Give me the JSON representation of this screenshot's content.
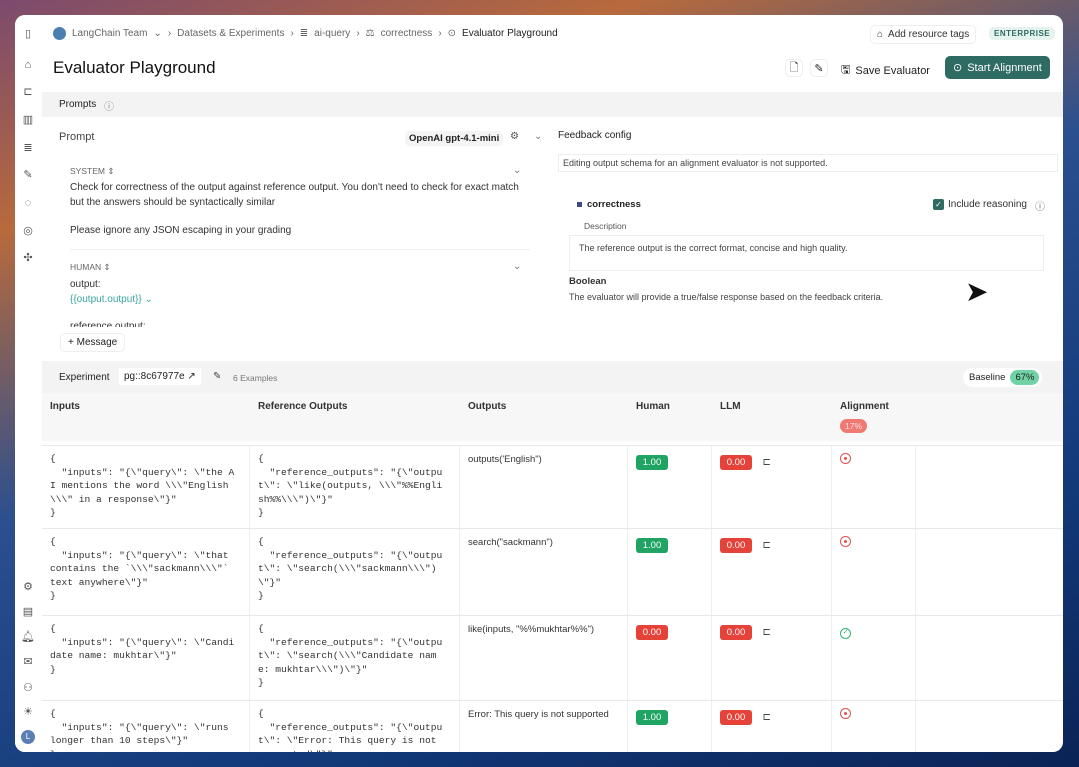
{
  "breadcrumb": {
    "org": "LangChain Team",
    "items": [
      "Datasets & Experiments",
      "ai-query",
      "correctness",
      "Evaluator Playground"
    ]
  },
  "header": {
    "add_tags": "Add resource tags",
    "plan": "ENTERPRISE",
    "title": "Evaluator Playground",
    "save": "Save Evaluator",
    "start": "Start Alignment"
  },
  "prompts": {
    "label": "Prompts",
    "prompt_label": "Prompt",
    "model": "OpenAI gpt-4.1-mini",
    "system_role": "SYSTEM",
    "system_text": "Check for correctness of the output against reference output. You don't need to check for exact match but the answers should be syntactically similar",
    "system_text2": "Please ignore any JSON escaping in your grading",
    "human_role": "HUMAN",
    "human_line1": "output:",
    "human_var": "{{output.output}}",
    "human_line3": "reference output:",
    "add_message": "+ Message"
  },
  "feedback": {
    "title": "Feedback config",
    "notice": "Editing output schema for an alignment evaluator is not supported.",
    "name": "correctness",
    "include_reasoning": "Include reasoning",
    "include_reasoning_checked": true,
    "desc_label": "Description",
    "desc": "The reference output is the correct format, concise and high quality.",
    "type": "Boolean",
    "type_desc": "The evaluator will provide a true/false response based on the feedback criteria."
  },
  "experiment": {
    "label": "Experiment",
    "id": "pg::8c67977e",
    "examples": "6 Examples",
    "baseline_label": "Baseline",
    "baseline": "67%"
  },
  "table": {
    "columns": [
      "Inputs",
      "Reference Outputs",
      "Outputs",
      "Human",
      "LLM",
      "Alignment"
    ],
    "alignment_score": "17%",
    "rows": [
      {
        "input": "{\n  \"inputs\": \"{\\\"query\\\": \\\"the AI mentions the word \\\\\\\"English\\\\\\\" in a response\\\"}\"\n}",
        "ref": "{\n  \"reference_outputs\": \"{\\\"output\\\": \\\"like(outputs, \\\\\\\"%%English%%\\\\\\\")\\\"}\"\n}",
        "output": "outputs('English\")",
        "human": "1.00",
        "llm": "0.00",
        "aligned": false
      },
      {
        "input": "{\n  \"inputs\": \"{\\\"query\\\": \\\"that contains the `\\\\\\\"sackmann\\\\\\\"` text anywhere\\\"}\"\n}",
        "ref": "{\n  \"reference_outputs\": \"{\\\"output\\\": \\\"search(\\\\\\\"sackmann\\\\\\\")\\\"}\"\n}",
        "output": "search(\"sackmann\")",
        "human": "1.00",
        "llm": "0.00",
        "aligned": false
      },
      {
        "input": "{\n  \"inputs\": \"{\\\"query\\\": \\\"Candidate name: mukhtar\\\"}\"\n}",
        "ref": "{\n  \"reference_outputs\": \"{\\\"output\\\": \\\"search(\\\\\\\"Candidate name: mukhtar\\\\\\\")\\\"}\"\n}",
        "output": "like(inputs, \"%%mukhtar%%\")",
        "human": "0.00",
        "llm": "0.00",
        "aligned": true
      },
      {
        "input": "{\n  \"inputs\": \"{\\\"query\\\": \\\"runs longer than 10 steps\\\"}\"\n}",
        "ref": "{\n  \"reference_outputs\": \"{\\\"output\\\": \\\"Error: This query is not supported\\\"}\"\n}",
        "output": "Error: This query is not supported",
        "human": "1.00",
        "llm": "0.00",
        "aligned": false
      }
    ]
  },
  "colors": {
    "accent": "#2d6b63",
    "pass": "#1fa463",
    "fail": "#e5423a"
  }
}
